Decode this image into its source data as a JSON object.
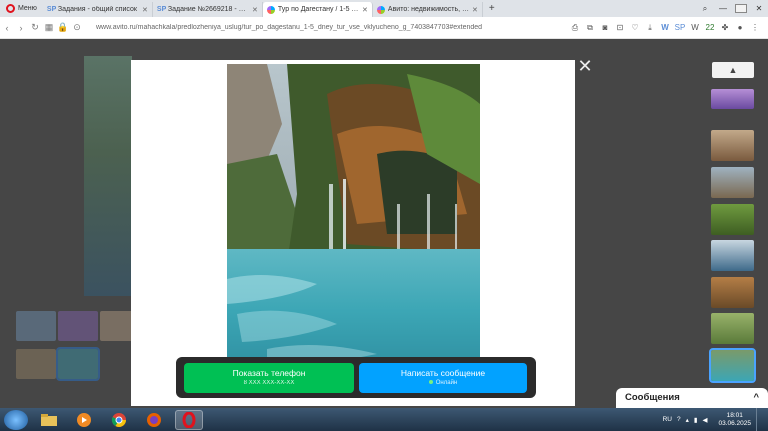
{
  "browser": {
    "menu_label": "Меню",
    "tabs": [
      {
        "title": "Задания - общий список",
        "favicon": "SP",
        "active": false
      },
      {
        "title": "Задание №2669218 - про",
        "favicon": "SP",
        "active": false
      },
      {
        "title": "Тур по Дагестану / 1-5 дн",
        "favicon": "avito",
        "active": true
      },
      {
        "title": "Авито: недвижимость, тра",
        "favicon": "avito",
        "active": false
      }
    ],
    "new_tab": "+",
    "url": "www.avito.ru/mahachkala/predlozheniya_uslug/tur_po_dagestanu_1-5_dney_tur_vse_vklyucheno_g_7403847703#extended",
    "extension_badge": "22"
  },
  "lightbox": {
    "close": "✕",
    "phone_button": {
      "label": "Показать телефон",
      "sub": "8 XXX XXX-XX-XX"
    },
    "message_button": {
      "label": "Написать сообщение",
      "sub": "Онлайн"
    },
    "thumbs_up": "▲"
  },
  "messages_widget": {
    "label": "Сообщения",
    "chevron": "^"
  },
  "taskbar": {
    "lang": "RU",
    "time": "18:01",
    "date": "03.06.2025",
    "apps": [
      "explorer",
      "media-player",
      "chrome",
      "firefox",
      "opera"
    ]
  },
  "colors": {
    "phone": "#00c054",
    "message": "#02a2ff",
    "online": "#8dff6a"
  }
}
